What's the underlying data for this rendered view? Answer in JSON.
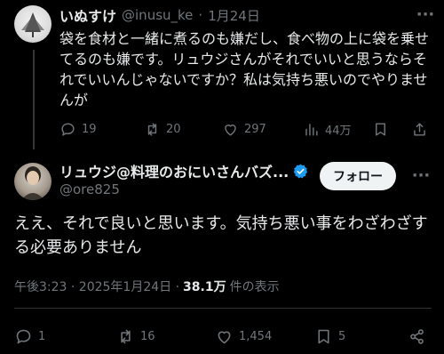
{
  "reply": {
    "name": "いぬすけ",
    "handle": "@inusu_ke",
    "separator": "·",
    "date": "1月24日",
    "text": "袋を食材と一緒に煮るのも嫌だし、食べ物の上に袋を乗せてるのも嫌です。リュウジさんがそれでいいと思うならそれでいいんじゃないですか？私は気持ち悪いのでやりませんが",
    "more_icon": "···",
    "actions": {
      "replies": "19",
      "reposts": "20",
      "likes": "297",
      "views": "44万"
    }
  },
  "main": {
    "name": "リュウジ@料理のおにいさんバズ...",
    "handle": "@ore825",
    "follow_label": "フォロー",
    "more_icon": "···",
    "text": "ええ、それで良いと思います。気持ち悪い事をわざわざする必要ありません",
    "timestamp": "午後3:23 · 2025年1月24日 ·",
    "views_count": "38.1万",
    "views_label": "件の表示",
    "actions": {
      "replies": "1",
      "reposts": "16",
      "likes": "1,454",
      "bookmarks": "5"
    }
  },
  "colors": {
    "background": "#000000",
    "text": "#e7e9ea",
    "muted": "#71767b",
    "verified": "#1d9bf0",
    "follow_bg": "#eff3f4"
  }
}
